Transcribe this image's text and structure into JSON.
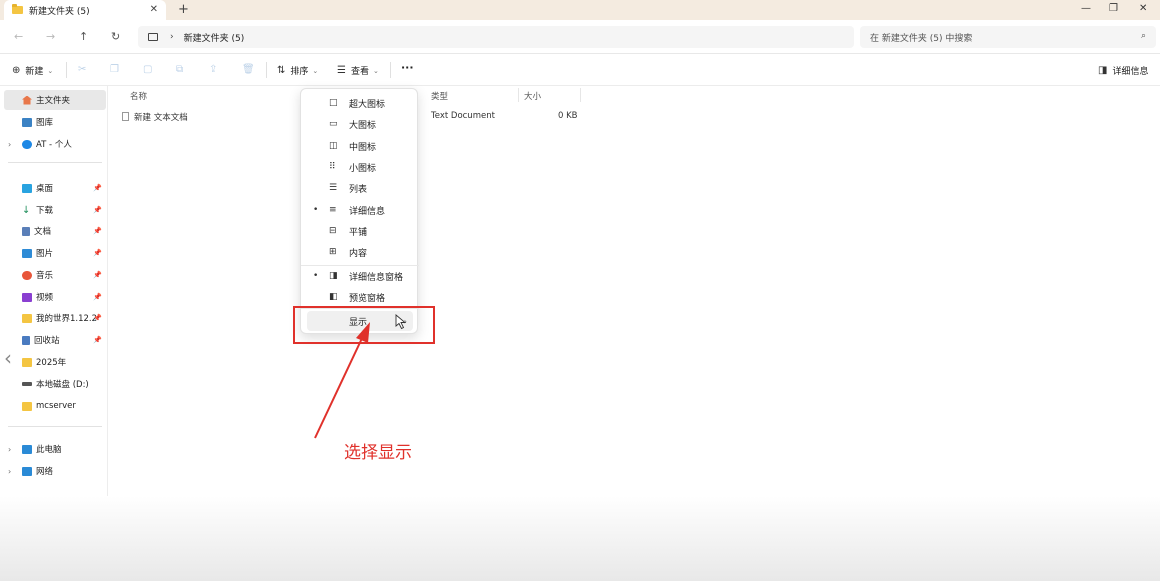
{
  "window": {
    "tab_title": "新建文件夹 (5)",
    "tab_close": "✕",
    "tab_add": "+",
    "controls": [
      "—",
      "❐",
      "✕"
    ]
  },
  "address": {
    "path": "新建文件夹 (5)",
    "search_placeholder": "在 新建文件夹 (5) 中搜索"
  },
  "toolbar": {
    "new_label": "新建",
    "sort_label": "排序",
    "view_label": "查看",
    "more_label": "···",
    "details_label": "详细信息"
  },
  "sidebar": {
    "items": [
      {
        "label": "主文件夹",
        "icon": "home-icon",
        "color": "#e8774a"
      },
      {
        "label": "图库",
        "icon": "gallery-icon",
        "color": "#3b82c4"
      },
      {
        "label": "AT - 个人",
        "icon": "cloud-icon",
        "color": "#1e88e5"
      },
      {
        "label": "桌面",
        "icon": "desktop-icon",
        "color": "#29a3e0"
      },
      {
        "label": "下载",
        "icon": "download-icon",
        "color": "#1e8e5a"
      },
      {
        "label": "文档",
        "icon": "document-icon",
        "color": "#5a7fb8"
      },
      {
        "label": "图片",
        "icon": "pictures-icon",
        "color": "#2e8bd6"
      },
      {
        "label": "音乐",
        "icon": "music-icon",
        "color": "#e8563a"
      },
      {
        "label": "视频",
        "icon": "video-icon",
        "color": "#8a3fd1"
      },
      {
        "label": "我的世界1.12.2",
        "icon": "folder-icon",
        "color": "#f4c542"
      },
      {
        "label": "回收站",
        "icon": "recycle-bin-icon",
        "color": "#4a7bc0"
      },
      {
        "label": "2025年",
        "icon": "folder-icon",
        "color": "#f4c542"
      },
      {
        "label": "本地磁盘 (D:)",
        "icon": "drive-icon",
        "color": "#555555"
      },
      {
        "label": "mcserver",
        "icon": "folder-icon",
        "color": "#f4c542"
      },
      {
        "label": "此电脑",
        "icon": "computer-icon",
        "color": "#2a8ad6"
      },
      {
        "label": "网络",
        "icon": "network-icon",
        "color": "#2a8ad6"
      }
    ]
  },
  "filelist": {
    "headers": {
      "name": "名称",
      "type": "类型",
      "size": "大小"
    },
    "rows": [
      {
        "name": "新建 文本文档",
        "type": "Text Document",
        "size": "0 KB"
      }
    ]
  },
  "menu": {
    "items": [
      {
        "label": "超大图标",
        "icon": "□",
        "checked": false
      },
      {
        "label": "大图标",
        "icon": "▭",
        "checked": false
      },
      {
        "label": "中图标",
        "icon": "◫",
        "checked": false
      },
      {
        "label": "小图标",
        "icon": "⠿",
        "checked": false
      },
      {
        "label": "列表",
        "icon": "☰",
        "checked": false
      },
      {
        "label": "详细信息",
        "icon": "≡",
        "checked": true
      },
      {
        "label": "平铺",
        "icon": "⊟",
        "checked": false
      },
      {
        "label": "内容",
        "icon": "⊞",
        "checked": false
      },
      {
        "label": "详细信息窗格",
        "icon": "◨",
        "checked": true
      },
      {
        "label": "预览窗格",
        "icon": "◧",
        "checked": false
      },
      {
        "label": "显示",
        "icon": "",
        "checked": false
      }
    ],
    "bullet": "•",
    "submenu_arrow": "›"
  },
  "annotation": {
    "text": "选择显示",
    "color": "#e0312b"
  }
}
